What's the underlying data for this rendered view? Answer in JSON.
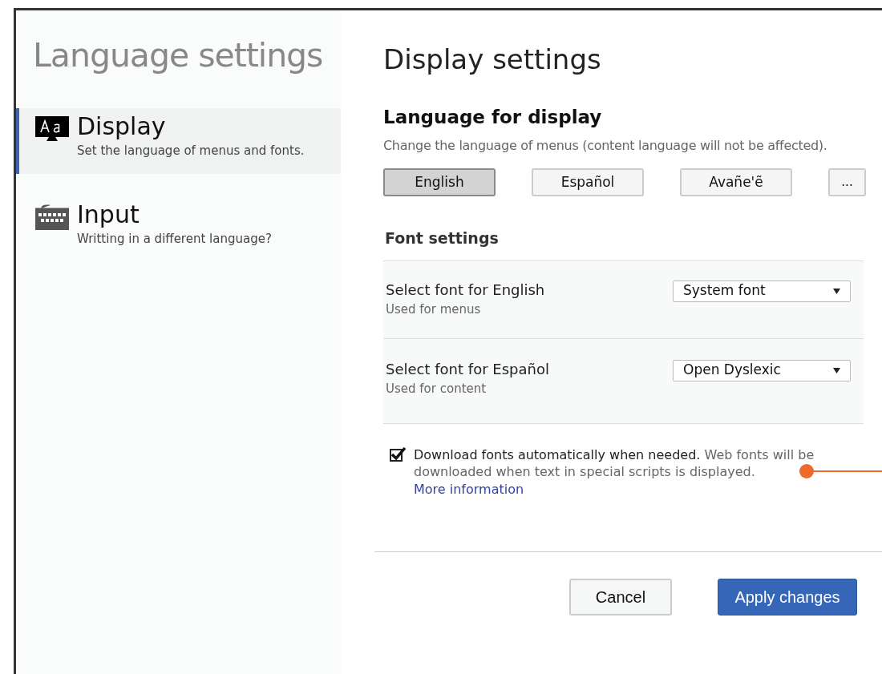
{
  "sidebar": {
    "title": "Language settings",
    "items": [
      {
        "kind": "display",
        "label": "Display",
        "description": "Set the language of menus and fonts.",
        "selected": true
      },
      {
        "kind": "keyboard",
        "label": "Input",
        "description": "Writting in a different language?",
        "selected": false
      }
    ]
  },
  "main": {
    "title": "Display settings",
    "language_section": {
      "heading": "Language for display",
      "description": "Change the language of menus (content language will not be affected).",
      "languages": [
        {
          "label": "English",
          "selected": true
        },
        {
          "label": "Español",
          "selected": false
        },
        {
          "label": "Avañe'ẽ",
          "selected": false
        }
      ],
      "more_button": "..."
    },
    "font_section": {
      "heading": "Font settings",
      "rows": [
        {
          "label": "Select font for English",
          "note": "Used for menus",
          "value": "System font"
        },
        {
          "label": "Select font for Español",
          "note": "Used for content",
          "value": "Open Dyslexic"
        }
      ]
    },
    "download_option": {
      "checked": true,
      "label": "Download fonts automatically when needed.",
      "description": "Web fonts will be downloaded when text in special scripts is displayed.",
      "link": "More information"
    },
    "buttons": [
      {
        "kind": "secondary",
        "label": "Cancel"
      },
      {
        "kind": "primary",
        "label": "Apply changes"
      }
    ]
  }
}
